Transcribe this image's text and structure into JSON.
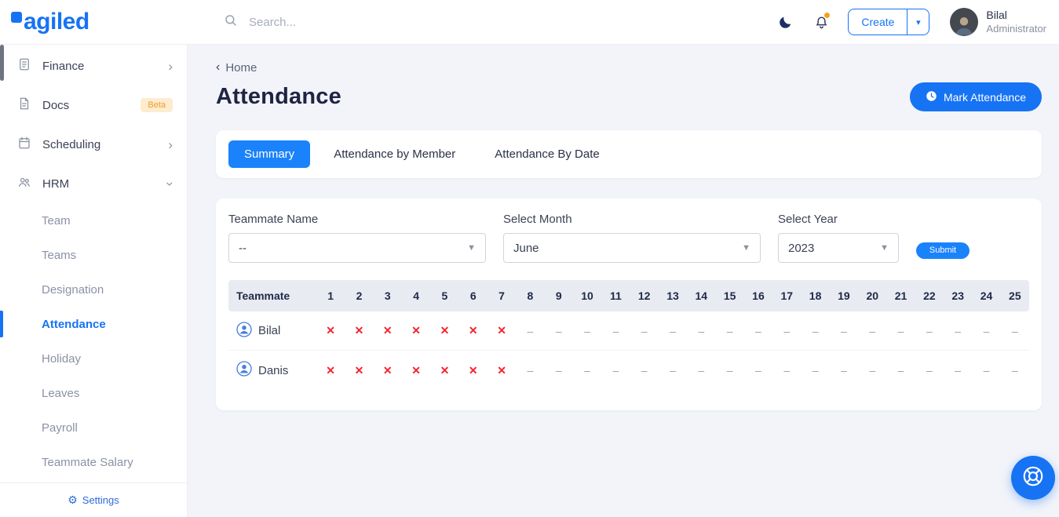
{
  "colors": {
    "accent": "#1673f4",
    "danger": "#f5232e",
    "active_tab": "#1a82fb"
  },
  "topbar": {
    "logo": "agiled",
    "search_placeholder": "Search...",
    "create_label": "Create",
    "user_name": "Bilal",
    "user_role": "Administrator"
  },
  "sidebar": {
    "items": [
      {
        "label": "Finance",
        "chevron": "right"
      },
      {
        "label": "Docs",
        "badge": "Beta"
      },
      {
        "label": "Scheduling",
        "chevron": "right"
      },
      {
        "label": "HRM",
        "chevron": "down"
      }
    ],
    "hrm_subitems": [
      {
        "label": "Team",
        "active": false
      },
      {
        "label": "Teams",
        "active": false
      },
      {
        "label": "Designation",
        "active": false
      },
      {
        "label": "Attendance",
        "active": true
      },
      {
        "label": "Holiday",
        "active": false
      },
      {
        "label": "Leaves",
        "active": false
      },
      {
        "label": "Payroll",
        "active": false
      },
      {
        "label": "Teammate Salary",
        "active": false
      }
    ],
    "settings_label": "Settings"
  },
  "page": {
    "breadcrumb": "Home",
    "title": "Attendance",
    "mark_attendance_label": "Mark Attendance"
  },
  "tabs": {
    "items": [
      "Summary",
      "Attendance by Member",
      "Attendance By Date"
    ],
    "active": "Summary"
  },
  "filters": {
    "teammate_label": "Teammate Name",
    "teammate_value": "--",
    "month_label": "Select Month",
    "month_value": "June",
    "year_label": "Select Year",
    "year_value": "2023",
    "submit_label": "Submit"
  },
  "attendance_table": {
    "first_header": "Teammate",
    "days": [
      "1",
      "2",
      "3",
      "4",
      "5",
      "6",
      "7",
      "8",
      "9",
      "10",
      "11",
      "12",
      "13",
      "14",
      "15",
      "16",
      "17",
      "18",
      "19",
      "20",
      "21",
      "22",
      "23",
      "24",
      "25"
    ],
    "absent_symbol": "✕",
    "none_symbol": "–",
    "rows": [
      {
        "name": "Bilal",
        "statuses": [
          "absent",
          "absent",
          "absent",
          "absent",
          "absent",
          "absent",
          "absent",
          "none",
          "none",
          "none",
          "none",
          "none",
          "none",
          "none",
          "none",
          "none",
          "none",
          "none",
          "none",
          "none",
          "none",
          "none",
          "none",
          "none",
          "none"
        ]
      },
      {
        "name": "Danis",
        "statuses": [
          "absent",
          "absent",
          "absent",
          "absent",
          "absent",
          "absent",
          "absent",
          "none",
          "none",
          "none",
          "none",
          "none",
          "none",
          "none",
          "none",
          "none",
          "none",
          "none",
          "none",
          "none",
          "none",
          "none",
          "none",
          "none",
          "none"
        ]
      }
    ]
  }
}
